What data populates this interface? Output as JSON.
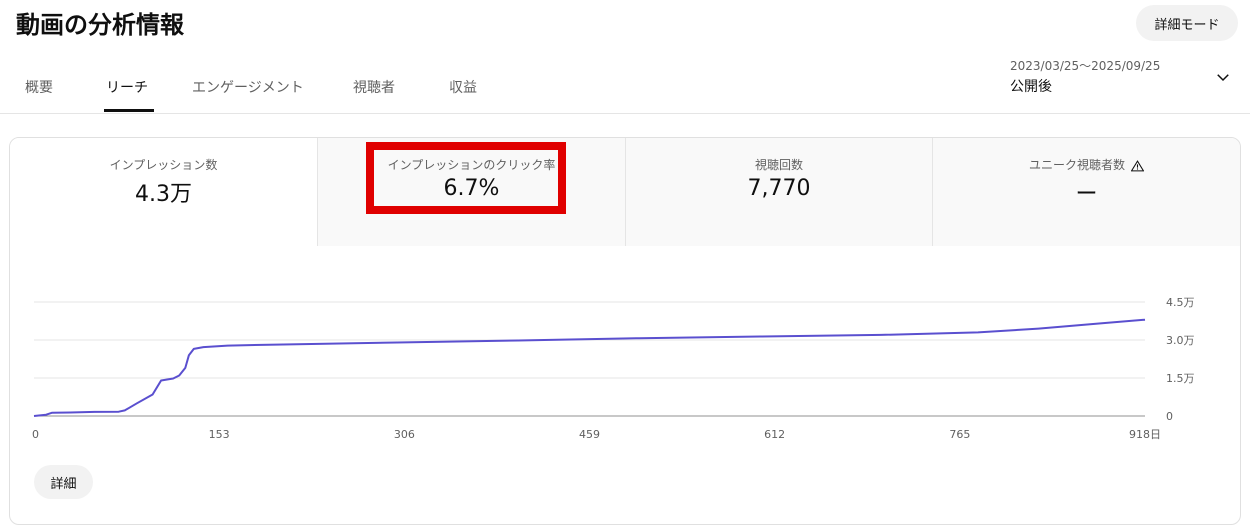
{
  "header": {
    "title": "動画の分析情報",
    "detail_mode_label": "詳細モード"
  },
  "tabs": [
    {
      "label": "概要",
      "active": false
    },
    {
      "label": "リーチ",
      "active": true
    },
    {
      "label": "エンゲージメント",
      "active": false
    },
    {
      "label": "視聴者",
      "active": false
    },
    {
      "label": "収益",
      "active": false
    }
  ],
  "date_filter": {
    "range": "2023/03/25～2025/09/25",
    "label": "公開後",
    "icon": "chevron-down-icon"
  },
  "metrics": [
    {
      "label": "インプレッション数",
      "value": "4.3万"
    },
    {
      "label": "インプレッションのクリック率",
      "value": "6.7%",
      "highlighted": true
    },
    {
      "label": "視聴回数",
      "value": "7,770"
    },
    {
      "label": "ユニーク視聴者数",
      "value": "ー",
      "icon": "warning-icon"
    }
  ],
  "colors": {
    "accent_line": "#5a4fcf",
    "highlight_box": "#e00000"
  },
  "chart_data": {
    "type": "line",
    "xlim": [
      0,
      918
    ],
    "ylim": [
      0,
      45000
    ],
    "x_ticks": [
      0,
      153,
      306,
      459,
      612,
      765,
      918
    ],
    "x_tick_labels": [
      "0",
      "153",
      "306",
      "459",
      "612",
      "765",
      "918日"
    ],
    "y_ticks": [
      0,
      15000,
      30000,
      45000
    ],
    "y_tick_labels": [
      "0",
      "1.5万",
      "3.0万",
      "4.5万"
    ],
    "grid": true,
    "series": [
      {
        "points": [
          [
            0,
            0
          ],
          [
            10,
            500
          ],
          [
            15,
            1300
          ],
          [
            30,
            1400
          ],
          [
            50,
            1600
          ],
          [
            70,
            1700
          ],
          [
            75,
            2200
          ],
          [
            85,
            5000
          ],
          [
            98,
            8500
          ],
          [
            105,
            14000
          ],
          [
            115,
            14800
          ],
          [
            120,
            16000
          ],
          [
            125,
            19000
          ],
          [
            128,
            24000
          ],
          [
            132,
            26500
          ],
          [
            140,
            27200
          ],
          [
            160,
            27800
          ],
          [
            200,
            28200
          ],
          [
            300,
            29000
          ],
          [
            400,
            29800
          ],
          [
            500,
            30700
          ],
          [
            600,
            31400
          ],
          [
            700,
            32000
          ],
          [
            780,
            33000
          ],
          [
            830,
            34500
          ],
          [
            880,
            36500
          ],
          [
            918,
            38000
          ]
        ]
      }
    ]
  },
  "footer": {
    "details_label": "詳細"
  }
}
